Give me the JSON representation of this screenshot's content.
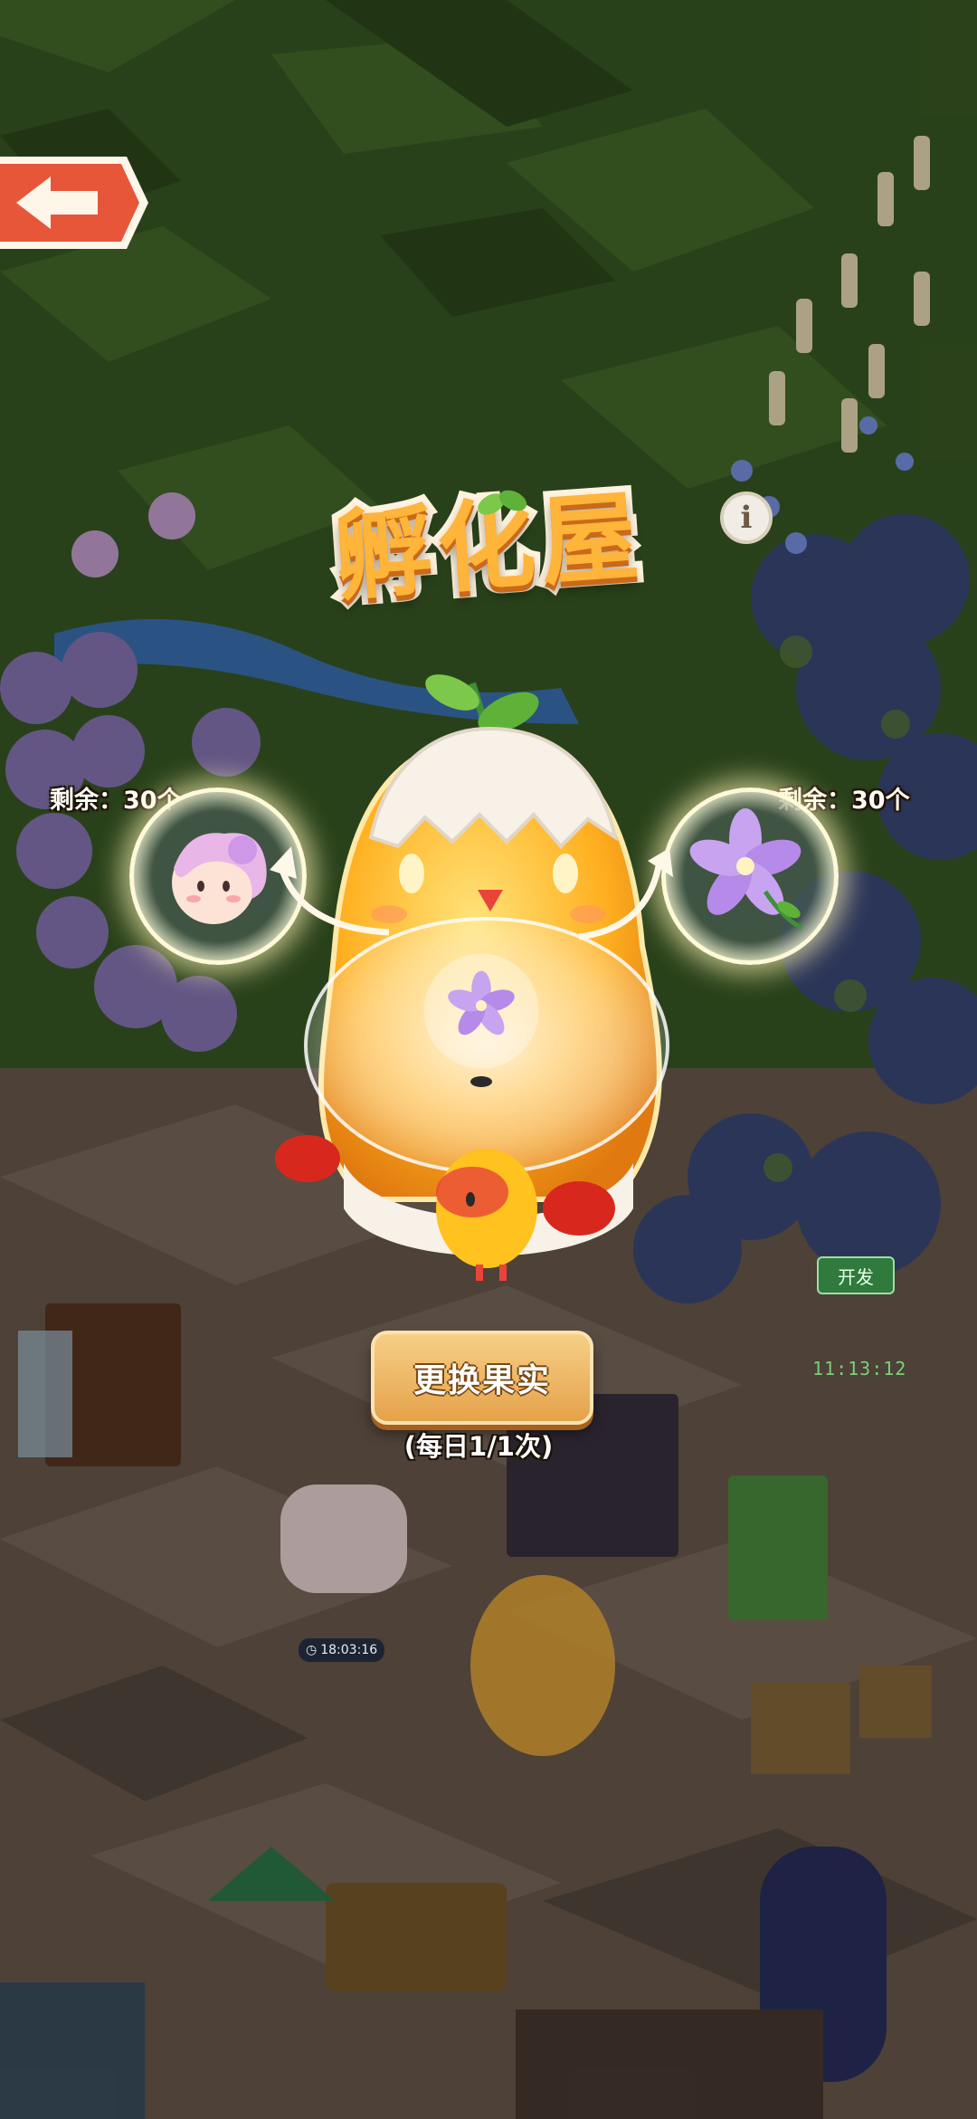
{
  "header": {
    "back_icon": "arrow-left-icon",
    "title": "孵化屋",
    "info_label": "i"
  },
  "hatch": {
    "left_remaining": "剩余：30个",
    "right_remaining": "剩余：30个",
    "left_item_icon": "pink-fluffy-creature-icon",
    "right_item_icon": "purple-flower-icon",
    "center_item_icon": "purple-flower-icon"
  },
  "actions": {
    "swap_label": "更换果实",
    "daily_limit": "(每日1/1次)"
  },
  "scene": {
    "dev_tag": "开发",
    "stall_timer": "11:13:12",
    "building_timer": "18:03:16"
  },
  "colors": {
    "accent_orange": "#ffa52a",
    "button_gold": "#e5a24a",
    "back_red": "#e8563a"
  }
}
